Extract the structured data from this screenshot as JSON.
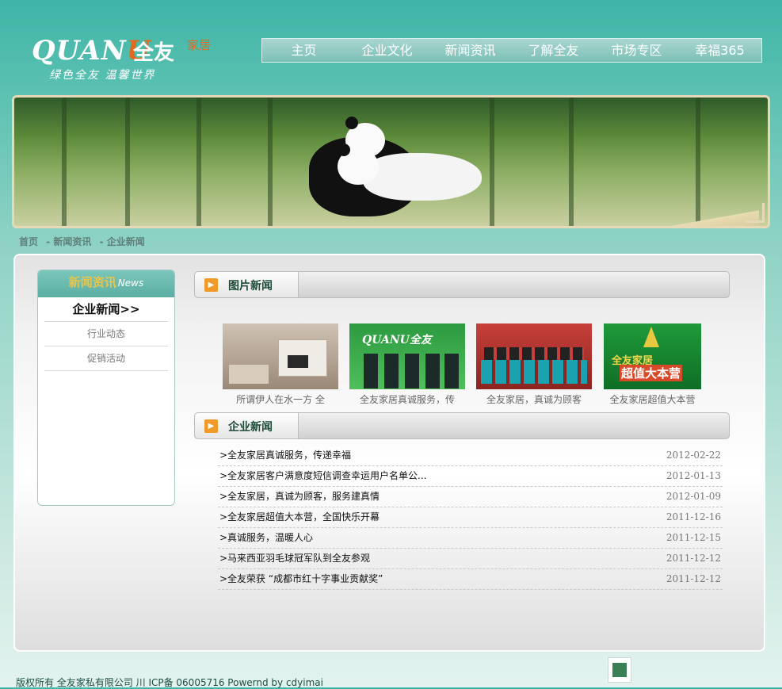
{
  "logo": {
    "mark_prefix": "QUAN",
    "mark_u": "U",
    "cn": "全友",
    "sub": "家居",
    "slogan": "绿色全友 温馨世界"
  },
  "nav": {
    "items": [
      "主页",
      "企业文化",
      "新闻资讯",
      "了解全友",
      "市场专区",
      "幸福365"
    ]
  },
  "breadcrumb": [
    "首页",
    "- 新闻资讯",
    "- 企业新闻"
  ],
  "sidebar": {
    "title_cn": "新闻资讯",
    "title_en": "News",
    "items": [
      "企业新闻>>",
      "行业动态",
      "促销活动"
    ]
  },
  "sections": {
    "photo_news": "图片新闻",
    "company_news": "企业新闻"
  },
  "photos": [
    {
      "caption": "所谓伊人在水一方 全"
    },
    {
      "caption": "全友家居真诚服务，传"
    },
    {
      "caption": "全友家居，真诚为顾客"
    },
    {
      "caption": "全友家居超值大本营"
    }
  ],
  "news": [
    {
      "title": ">全友家居真诚服务，传递幸福",
      "date": "2012-02-22"
    },
    {
      "title": ">全友家居客户满意度短信调查幸运用户名单公...",
      "date": "2012-01-13"
    },
    {
      "title": ">全友家居，真诚为顾客，服务建真情",
      "date": "2012-01-09"
    },
    {
      "title": ">全友家居超值大本营，全国快乐开幕",
      "date": "2011-12-16"
    },
    {
      "title": ">真诚服务，温暖人心",
      "date": "2011-12-15"
    },
    {
      "title": ">马来西亚羽毛球冠军队到全友参观",
      "date": "2011-12-12"
    },
    {
      "title": ">全友荣获 “成都市红十字事业贡献奖”",
      "date": "2011-12-12"
    }
  ],
  "footer": {
    "text": "版权所有 全友家私有限公司 川 ICP备 06005716 Powernd by cdyimai"
  },
  "colors": {
    "brand_orange": "#e06a1e",
    "teal": "#3fb5a6",
    "section_icon": "#f09a2a"
  }
}
